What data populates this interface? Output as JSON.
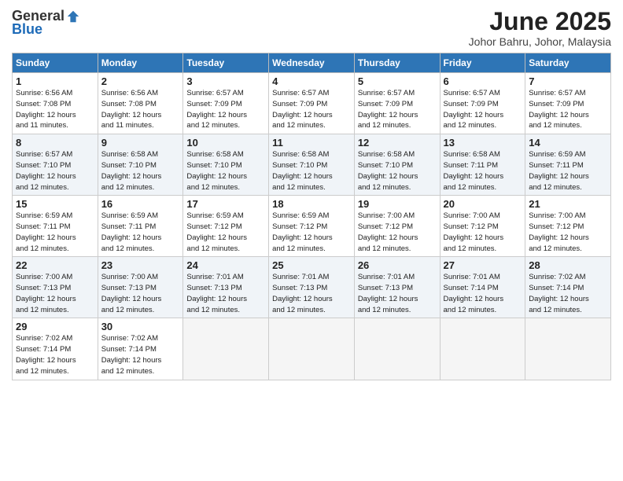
{
  "logo": {
    "general": "General",
    "blue": "Blue"
  },
  "title": "June 2025",
  "subtitle": "Johor Bahru, Johor, Malaysia",
  "days_header": [
    "Sunday",
    "Monday",
    "Tuesday",
    "Wednesday",
    "Thursday",
    "Friday",
    "Saturday"
  ],
  "weeks": [
    [
      {
        "num": "1",
        "info": "Sunrise: 6:56 AM\nSunset: 7:08 PM\nDaylight: 12 hours\nand 11 minutes."
      },
      {
        "num": "2",
        "info": "Sunrise: 6:56 AM\nSunset: 7:08 PM\nDaylight: 12 hours\nand 11 minutes."
      },
      {
        "num": "3",
        "info": "Sunrise: 6:57 AM\nSunset: 7:09 PM\nDaylight: 12 hours\nand 12 minutes."
      },
      {
        "num": "4",
        "info": "Sunrise: 6:57 AM\nSunset: 7:09 PM\nDaylight: 12 hours\nand 12 minutes."
      },
      {
        "num": "5",
        "info": "Sunrise: 6:57 AM\nSunset: 7:09 PM\nDaylight: 12 hours\nand 12 minutes."
      },
      {
        "num": "6",
        "info": "Sunrise: 6:57 AM\nSunset: 7:09 PM\nDaylight: 12 hours\nand 12 minutes."
      },
      {
        "num": "7",
        "info": "Sunrise: 6:57 AM\nSunset: 7:09 PM\nDaylight: 12 hours\nand 12 minutes."
      }
    ],
    [
      {
        "num": "8",
        "info": "Sunrise: 6:57 AM\nSunset: 7:10 PM\nDaylight: 12 hours\nand 12 minutes."
      },
      {
        "num": "9",
        "info": "Sunrise: 6:58 AM\nSunset: 7:10 PM\nDaylight: 12 hours\nand 12 minutes."
      },
      {
        "num": "10",
        "info": "Sunrise: 6:58 AM\nSunset: 7:10 PM\nDaylight: 12 hours\nand 12 minutes."
      },
      {
        "num": "11",
        "info": "Sunrise: 6:58 AM\nSunset: 7:10 PM\nDaylight: 12 hours\nand 12 minutes."
      },
      {
        "num": "12",
        "info": "Sunrise: 6:58 AM\nSunset: 7:10 PM\nDaylight: 12 hours\nand 12 minutes."
      },
      {
        "num": "13",
        "info": "Sunrise: 6:58 AM\nSunset: 7:11 PM\nDaylight: 12 hours\nand 12 minutes."
      },
      {
        "num": "14",
        "info": "Sunrise: 6:59 AM\nSunset: 7:11 PM\nDaylight: 12 hours\nand 12 minutes."
      }
    ],
    [
      {
        "num": "15",
        "info": "Sunrise: 6:59 AM\nSunset: 7:11 PM\nDaylight: 12 hours\nand 12 minutes."
      },
      {
        "num": "16",
        "info": "Sunrise: 6:59 AM\nSunset: 7:11 PM\nDaylight: 12 hours\nand 12 minutes."
      },
      {
        "num": "17",
        "info": "Sunrise: 6:59 AM\nSunset: 7:12 PM\nDaylight: 12 hours\nand 12 minutes."
      },
      {
        "num": "18",
        "info": "Sunrise: 6:59 AM\nSunset: 7:12 PM\nDaylight: 12 hours\nand 12 minutes."
      },
      {
        "num": "19",
        "info": "Sunrise: 7:00 AM\nSunset: 7:12 PM\nDaylight: 12 hours\nand 12 minutes."
      },
      {
        "num": "20",
        "info": "Sunrise: 7:00 AM\nSunset: 7:12 PM\nDaylight: 12 hours\nand 12 minutes."
      },
      {
        "num": "21",
        "info": "Sunrise: 7:00 AM\nSunset: 7:12 PM\nDaylight: 12 hours\nand 12 minutes."
      }
    ],
    [
      {
        "num": "22",
        "info": "Sunrise: 7:00 AM\nSunset: 7:13 PM\nDaylight: 12 hours\nand 12 minutes."
      },
      {
        "num": "23",
        "info": "Sunrise: 7:00 AM\nSunset: 7:13 PM\nDaylight: 12 hours\nand 12 minutes."
      },
      {
        "num": "24",
        "info": "Sunrise: 7:01 AM\nSunset: 7:13 PM\nDaylight: 12 hours\nand 12 minutes."
      },
      {
        "num": "25",
        "info": "Sunrise: 7:01 AM\nSunset: 7:13 PM\nDaylight: 12 hours\nand 12 minutes."
      },
      {
        "num": "26",
        "info": "Sunrise: 7:01 AM\nSunset: 7:13 PM\nDaylight: 12 hours\nand 12 minutes."
      },
      {
        "num": "27",
        "info": "Sunrise: 7:01 AM\nSunset: 7:14 PM\nDaylight: 12 hours\nand 12 minutes."
      },
      {
        "num": "28",
        "info": "Sunrise: 7:02 AM\nSunset: 7:14 PM\nDaylight: 12 hours\nand 12 minutes."
      }
    ],
    [
      {
        "num": "29",
        "info": "Sunrise: 7:02 AM\nSunset: 7:14 PM\nDaylight: 12 hours\nand 12 minutes."
      },
      {
        "num": "30",
        "info": "Sunrise: 7:02 AM\nSunset: 7:14 PM\nDaylight: 12 hours\nand 12 minutes."
      },
      {
        "num": "",
        "info": ""
      },
      {
        "num": "",
        "info": ""
      },
      {
        "num": "",
        "info": ""
      },
      {
        "num": "",
        "info": ""
      },
      {
        "num": "",
        "info": ""
      }
    ]
  ]
}
